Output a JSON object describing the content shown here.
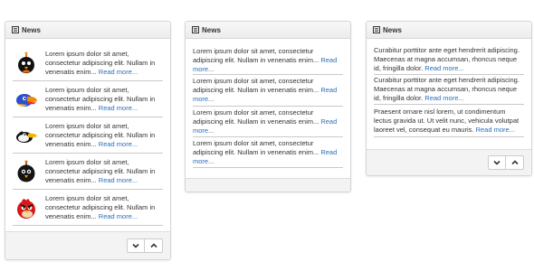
{
  "panels": [
    {
      "title": "News",
      "items": [
        {
          "icon": "black-bird-icon",
          "text": "Lorem ipsum dolor sit amet, consectetur adipiscing elit. Nullam in venenatis enim...",
          "link": "Read more..."
        },
        {
          "icon": "toucan-bird-icon",
          "text": "Lorem ipsum dolor sit amet, consectetur adipiscing elit. Nullam in venenatis enim...",
          "link": "Read more..."
        },
        {
          "icon": "white-bird-icon",
          "text": "Lorem ipsum dolor sit amet, consectetur adipiscing elit. Nullam in venenatis enim...",
          "link": "Read more..."
        },
        {
          "icon": "bomb-bird-icon",
          "text": "Lorem ipsum dolor sit amet, consectetur adipiscing elit. Nullam in venenatis enim...",
          "link": "Read more..."
        },
        {
          "icon": "red-bird-icon",
          "text": "Lorem ipsum dolor sit amet, consectetur adipiscing elit. Nullam in venenatis enim...",
          "link": "Read more..."
        }
      ]
    },
    {
      "title": "News",
      "items": [
        {
          "text": "Lorem ipsum dolor sit amet, consectetur adipiscing elit. Nullam in venenatis enim...",
          "link": "Read more..."
        },
        {
          "text": "Lorem ipsum dolor sit amet, consectetur adipiscing elit. Nullam in venenatis enim...",
          "link": "Read more..."
        },
        {
          "text": "Lorem ipsum dolor sit amet, consectetur adipiscing elit. Nullam in venenatis enim...",
          "link": "Read more..."
        },
        {
          "text": "Lorem ipsum dolor sit amet, consectetur adipiscing elit. Nullam in venenatis enim...",
          "link": "Read more..."
        }
      ]
    },
    {
      "title": "News",
      "items": [
        {
          "text": "Curabitur porttitor ante eget hendrerit adipiscing. Maecenas at magna accumsan, rhoncus neque id, fringilla dolor.",
          "link": "Read more..."
        },
        {
          "text": "Curabitur porttitor ante eget hendrerit adipiscing. Maecenas at magna accumsan, rhoncus neque id, fringilla dolor.",
          "link": "Read more..."
        },
        {
          "text": "Praesent ornare nisl lorem, ut condimentum lectus gravida ut. Ut velit nunc, vehicula volutpat laoreet vel, consequat eu mauris.",
          "link": "Read more..."
        }
      ]
    }
  ],
  "icons": {
    "heading": "newspaper-icon",
    "down": "chevron-down-icon",
    "up": "chevron-up-icon"
  },
  "colors": {
    "link": "#2a6ebb",
    "border": "#d6d6d6"
  }
}
